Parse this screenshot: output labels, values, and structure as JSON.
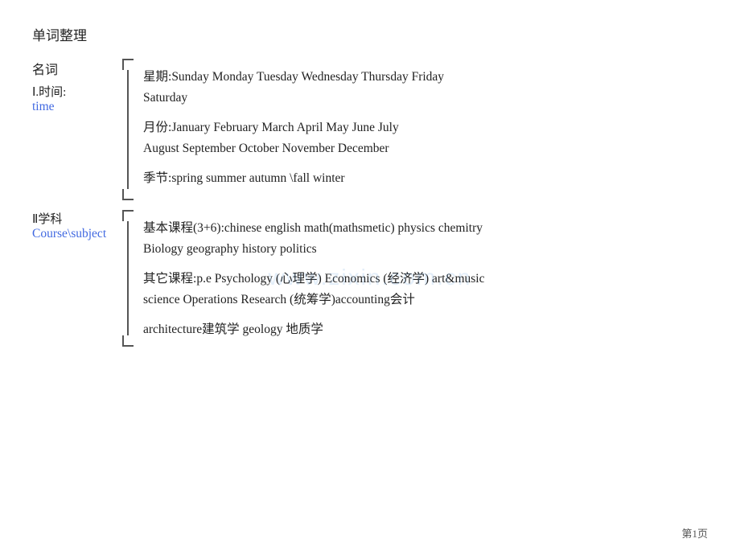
{
  "page": {
    "title": "单词整理",
    "page_num": "第1页",
    "watermark": "www.zixin.com.cn"
  },
  "noun_section": {
    "label_noun": "名词",
    "label_roman": "Ⅰ.时间:",
    "label_time": "time",
    "days_label": "星期:",
    "days": "Sunday  Monday  Tuesday  Wednesday  Thursday  Friday",
    "days2": "Saturday",
    "months_label": "月份:",
    "months1": "January    February    March    April  May June  July",
    "months2": "August    September  October   November   December",
    "seasons_label": "季节:",
    "seasons": "spring    summer      autumn \\fall      winter"
  },
  "subject_section": {
    "label_roman": "Ⅱ学科",
    "label_blue": "Course\\subject",
    "basic_label": "基本课程(3+6):",
    "basic_courses": "chinese  english math(mathsmetic) physics chemitry",
    "basic_courses2": "Biology  geography history  politics",
    "other_label": "其它课程:",
    "other_courses": "p.e Psychology (心理学) Economics (经济学) art&music",
    "other_courses2": "science   Operations Research (统筹学)accounting会计",
    "other_courses3": "architecture建筑学 geology 地质学"
  }
}
